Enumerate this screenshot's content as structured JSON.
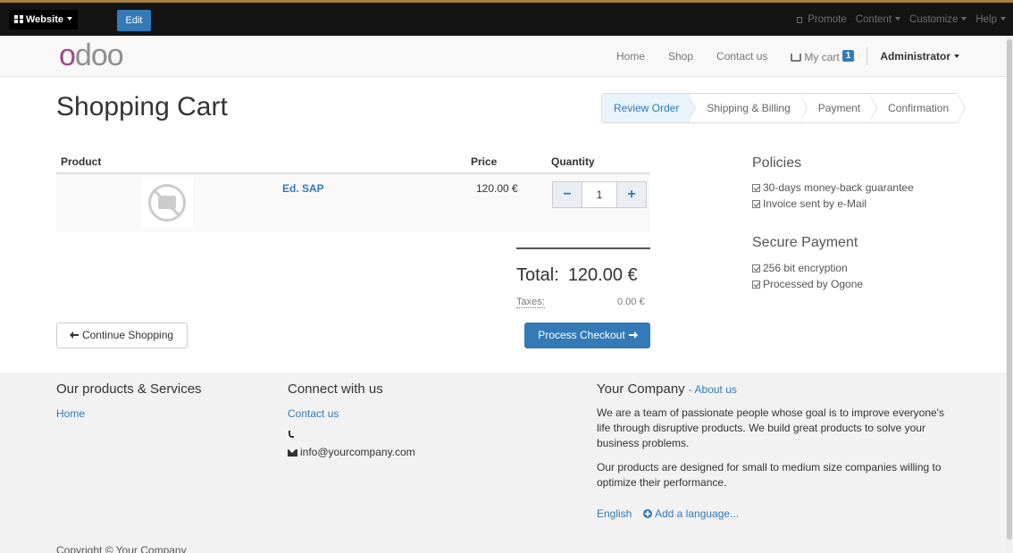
{
  "adminbar": {
    "website_label": "Website",
    "edit_label": "Edit",
    "promote_label": "Promote",
    "content_label": "Content",
    "customize_label": "Customize",
    "help_label": "Help"
  },
  "navbar": {
    "logo_text": "odoo",
    "home": "Home",
    "shop": "Shop",
    "contact": "Contact us",
    "cart_label": "My cart",
    "cart_count": "1",
    "user": "Administrator"
  },
  "page": {
    "title": "Shopping Cart"
  },
  "wizard": {
    "steps": [
      "Review Order",
      "Shipping & Billing",
      "Payment",
      "Confirmation"
    ],
    "active_index": 0
  },
  "cart": {
    "headers": {
      "product": "Product",
      "price": "Price",
      "quantity": "Quantity"
    },
    "items": [
      {
        "name": "Ed. SAP",
        "price": "120.00 €",
        "quantity": "1"
      }
    ],
    "total_label": "Total:",
    "total_value": "120.00 €",
    "taxes_label": "Taxes:",
    "taxes_value": "0.00 €",
    "continue_label": "Continue Shopping",
    "checkout_label": "Process Checkout"
  },
  "sidebar": {
    "policies_title": "Policies",
    "policies": [
      "30-days money-back guarantee",
      "Invoice sent by e-Mail"
    ],
    "payment_title": "Secure Payment",
    "payment": [
      "256 bit encryption",
      "Processed by Ogone"
    ]
  },
  "footer": {
    "products_title": "Our products & Services",
    "products_home": "Home",
    "connect_title": "Connect with us",
    "contact_link": "Contact us",
    "email": "info@yourcompany.com",
    "company_title": "Your Company",
    "about_link": "- About us",
    "about_p1": "We are a team of passionate people whose goal is to improve everyone's life through disruptive products. We build great products to solve your business problems.",
    "about_p2": "Our products are designed for small to medium size companies willing to optimize their performance.",
    "language": "English",
    "add_language": "Add a language...",
    "copyright": "Copyright © Your Company"
  },
  "colors": {
    "primary": "#337ab7",
    "logo_accent": "#a24689",
    "adminbar": "#141414"
  }
}
